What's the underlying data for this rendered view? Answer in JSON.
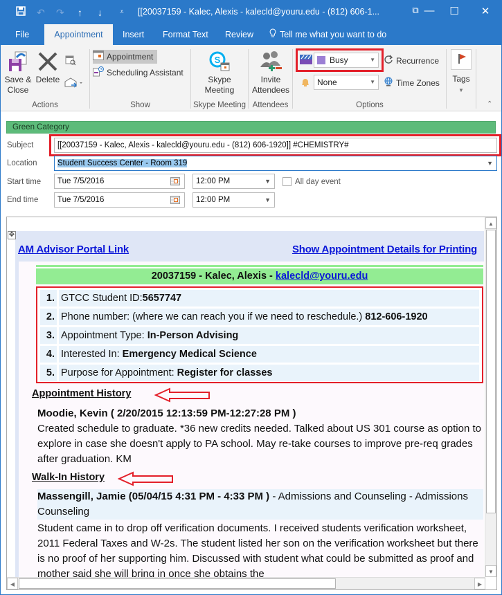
{
  "window": {
    "title": "[[20037159 - Kalec, Alexis - kalecld@youru.edu  - (812) 606-1...",
    "quick_access": [
      "save-icon",
      "undo-icon",
      "redo-icon",
      "previous-item-icon",
      "next-item-icon",
      "customize-qat-icon"
    ],
    "controls": {
      "ribbon_display": "⧉",
      "minimize": "—",
      "maximize": "☐",
      "close": "✕"
    }
  },
  "tabs": [
    {
      "label": "File",
      "active": false
    },
    {
      "label": "Appointment",
      "active": true
    },
    {
      "label": "Insert",
      "active": false
    },
    {
      "label": "Format Text",
      "active": false
    },
    {
      "label": "Review",
      "active": false
    }
  ],
  "tell_me": "Tell me what you want to do",
  "ribbon": {
    "actions": {
      "label": "Actions",
      "save_close": [
        "Save &",
        "Close"
      ],
      "delete": "Delete"
    },
    "show": {
      "label": "Show",
      "appointment": "Appointment",
      "scheduling": "Scheduling Assistant"
    },
    "skype": {
      "label": "Skype Meeting",
      "button": [
        "Skype",
        "Meeting"
      ]
    },
    "attendees": {
      "label": "Attendees",
      "button": [
        "Invite",
        "Attendees"
      ]
    },
    "options": {
      "label": "Options",
      "show_as": "Busy",
      "show_as_color": "#9b7fd4",
      "reminder": "None",
      "recurrence": "Recurrence",
      "time_zones": "Time Zones"
    },
    "tags": {
      "label": "Tags"
    }
  },
  "form": {
    "category": "Green Category",
    "category_color": "#5dbb7a",
    "subject_label": "Subject",
    "subject": "[[20037159 - Kalec, Alexis - kalecld@youru.edu  - (812) 606-1920]] #CHEMISTRY#",
    "location_label": "Location",
    "location": "Student Success Center - Room 319",
    "start_label": "Start time",
    "start_date": "Tue 7/5/2016",
    "start_time": "12:00 PM",
    "all_day_label": "All day event",
    "all_day": false,
    "end_label": "End time",
    "end_date": "Tue 7/5/2016",
    "end_time": "12:00 PM"
  },
  "body": {
    "portal_link": "AM Advisor Portal Link",
    "print_link": "Show Appointment Details for Printing",
    "student_header": "20037159 - Kalec, Alexis - ",
    "student_email": "kalecld@youru.edu",
    "details": [
      {
        "num": "1.",
        "label": "GTCC Student ID:",
        "value": "5657747"
      },
      {
        "num": "2.",
        "label": "Phone number: (where we can reach you if we need to reschedule.) ",
        "value": "812-606-1920"
      },
      {
        "num": "3.",
        "label": "Appointment Type: ",
        "value": "In-Person Advising"
      },
      {
        "num": "4.",
        "label": "Interested In: ",
        "value": "Emergency Medical Science"
      },
      {
        "num": "5.",
        "label": "Purpose for Appointment: ",
        "value": "Register for classes"
      }
    ],
    "appointment_history": {
      "heading": "Appointment History",
      "entry_title": "Moodie, Kevin ( 2/20/2015 12:13:59 PM-12:27:28 PM )",
      "entry_text": "Created schedule to graduate. *36 new credits needed. Talked about US 301 course as option to explore in case she doesn't apply to PA school. May re-take courses to improve pre-req grades after graduation. KM"
    },
    "walkin_history": {
      "heading": "Walk-In History",
      "entry_title": "Massengill, Jamie (05/04/15 4:31 PM - 4:33 PM )",
      "entry_dept": " - Admissions and Counseling - Admissions Counseling",
      "entry_text": "Student came in to drop off verification documents. I received students verification worksheet, 2011 Federal Taxes and W-2s. The student listed her son on the verification worksheet but there is no proof of her supporting him. Discussed with student what could be submitted as proof and mother said she will bring in once she obtains the"
    }
  }
}
